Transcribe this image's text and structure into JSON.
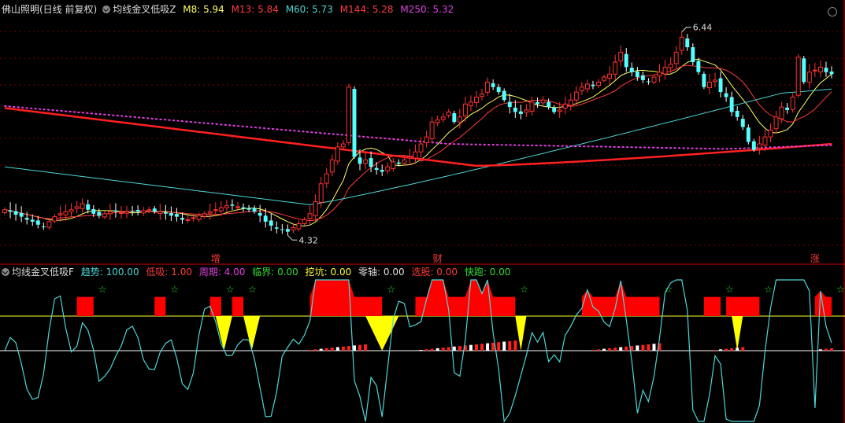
{
  "main_header": {
    "title": "佛山照明(日线 前复权)",
    "indicator_name": "均线金叉低吸Z",
    "items": [
      {
        "label": "M8: 5.94",
        "color": "#ffff66"
      },
      {
        "label": "M13: 5.84",
        "color": "#ff3b3b"
      },
      {
        "label": "M60: 5.73",
        "color": "#4fd5d5"
      },
      {
        "label": "M144: 5.28",
        "color": "#ff3b3b"
      },
      {
        "label": "M250: 5.32",
        "color": "#e040e0"
      }
    ]
  },
  "price_chart": {
    "high_label": "6.44",
    "low_label": "4.32"
  },
  "event_markers": [
    {
      "label": "增",
      "index": 38
    },
    {
      "label": "财",
      "index": 78
    },
    {
      "label": "涨",
      "index": 146
    }
  ],
  "indicator_header": {
    "title": "均线金叉低吸F",
    "items": [
      {
        "label": "趋势: 100.00",
        "color": "#4fd5d5"
      },
      {
        "label": "低吸: 1.00",
        "color": "#ff3b3b"
      },
      {
        "label": "周期: 4.00",
        "color": "#e040e0"
      },
      {
        "label": "临界: 0.00",
        "color": "#33dd33"
      },
      {
        "label": "挖坑: 0.00",
        "color": "#ffff33"
      },
      {
        "label": "零轴: 0.00",
        "color": "#dddddd"
      },
      {
        "label": "选股: 0.00",
        "color": "#ff3b3b"
      },
      {
        "label": "快跑: 0.00",
        "color": "#33dd33"
      }
    ]
  },
  "colors": {
    "up": "#ff3232",
    "down": "#54ffff",
    "m8": "#ffff66",
    "m13": "#ff3b3b",
    "m60": "#4fd5d5",
    "m144": "#ff2020",
    "m250": "#e040e0",
    "trend": "#4fd5d5"
  },
  "chart_data": {
    "type": "candlestick",
    "count": 150,
    "ylim": [
      4.2,
      6.55
    ],
    "closes": [
      4.62,
      4.6,
      4.57,
      4.55,
      4.52,
      4.5,
      4.47,
      4.45,
      4.5,
      4.55,
      4.58,
      4.6,
      4.62,
      4.65,
      4.68,
      4.62,
      4.58,
      4.56,
      4.58,
      4.6,
      4.6,
      4.59,
      4.6,
      4.6,
      4.6,
      4.61,
      4.62,
      4.6,
      4.6,
      4.58,
      4.56,
      4.55,
      4.52,
      4.52,
      4.54,
      4.56,
      4.58,
      4.6,
      4.62,
      4.64,
      4.66,
      4.66,
      4.65,
      4.63,
      4.62,
      4.6,
      4.56,
      4.5,
      4.46,
      4.43,
      4.42,
      4.4,
      4.44,
      4.48,
      4.52,
      4.58,
      4.7,
      4.88,
      4.98,
      5.12,
      5.25,
      5.28,
      5.85,
      5.15,
      5.08,
      5.12,
      5.05,
      5.02,
      5.0,
      5.05,
      5.1,
      5.08,
      5.12,
      5.15,
      5.2,
      5.28,
      5.35,
      5.5,
      5.52,
      5.55,
      5.6,
      5.5,
      5.55,
      5.68,
      5.7,
      5.75,
      5.78,
      5.9,
      5.85,
      5.8,
      5.72,
      5.65,
      5.6,
      5.58,
      5.62,
      5.7,
      5.68,
      5.72,
      5.65,
      5.6,
      5.62,
      5.68,
      5.72,
      5.8,
      5.85,
      5.88,
      5.86,
      5.9,
      5.95,
      5.98,
      6.1,
      6.2,
      6.05,
      6.0,
      5.95,
      5.92,
      5.9,
      5.95,
      6.0,
      6.05,
      6.08,
      6.2,
      6.35,
      6.25,
      6.1,
      6.0,
      5.85,
      5.9,
      5.92,
      5.8,
      5.75,
      5.6,
      5.55,
      5.45,
      5.3,
      5.22,
      5.28,
      5.35,
      5.42,
      5.55,
      5.65,
      5.62,
      5.75,
      6.15,
      5.9,
      6.0,
      6.02,
      6.05,
      6.0,
      5.98
    ]
  }
}
